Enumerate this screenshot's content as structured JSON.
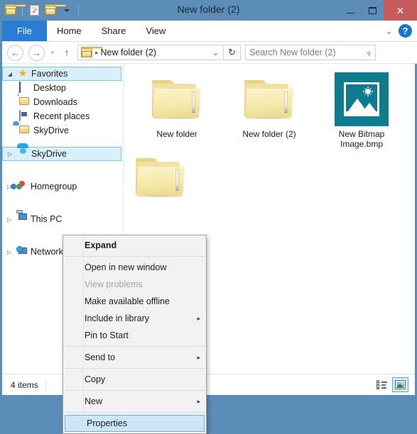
{
  "window": {
    "title": "New folder (2)",
    "quick_access": [
      {
        "name": "folder-icon",
        "label": "System menu"
      },
      {
        "name": "properties-icon",
        "label": "Properties"
      },
      {
        "name": "new-folder-icon",
        "label": "New folder"
      },
      {
        "name": "customize-caret-icon",
        "label": "Customize Quick Access Toolbar"
      }
    ],
    "controls": {
      "minimize": "–",
      "maximize": "☐",
      "close": "✕"
    },
    "accent_color": "#5b8db8",
    "close_color": "#c75b5b"
  },
  "ribbon": {
    "tabs": [
      {
        "label": "File",
        "active": true
      },
      {
        "label": "Home",
        "active": false
      },
      {
        "label": "Share",
        "active": false
      },
      {
        "label": "View",
        "active": false
      }
    ],
    "expand_caret": "⌄",
    "help_label": "?"
  },
  "addressbar": {
    "back": "←",
    "forward": "→",
    "history_caret": "▾",
    "up": "↑",
    "crumbs": [
      "New folder (2)"
    ],
    "crumb_separator": "▸",
    "dropdown_caret": "⌄",
    "refresh": "↻",
    "search": {
      "placeholder": "Search New folder (2)",
      "value": "",
      "icon": "⌕"
    }
  },
  "sidebar": {
    "groups": [
      {
        "root": {
          "label": "Favorites",
          "icon": "star-icon",
          "expander": "◢",
          "selected": true
        },
        "children": [
          {
            "label": "Desktop",
            "icon": "desktop-icon"
          },
          {
            "label": "Downloads",
            "icon": "downloads-icon"
          },
          {
            "label": "Recent places",
            "icon": "recent-places-icon"
          },
          {
            "label": "SkyDrive",
            "icon": "skydrive-folder-icon"
          }
        ]
      },
      {
        "root": {
          "label": "SkyDrive",
          "icon": "cloud-icon",
          "expander": "▷",
          "selected": true
        },
        "children": []
      },
      {
        "root": {
          "label": "Homegroup",
          "icon": "homegroup-icon",
          "expander": "▷",
          "selected": false
        },
        "children": []
      },
      {
        "root": {
          "label": "This PC",
          "icon": "this-pc-icon",
          "expander": "▷",
          "selected": false
        },
        "children": []
      },
      {
        "root": {
          "label": "Network",
          "icon": "network-icon",
          "expander": "▷",
          "selected": false
        },
        "children": []
      }
    ]
  },
  "content": {
    "items": [
      {
        "label": "New folder",
        "type": "folder"
      },
      {
        "label": "New folder (2)",
        "type": "folder"
      },
      {
        "label": "New Bitmap\nImage.bmp",
        "label_line1": "New Bitmap",
        "label_line2": "Image.bmp",
        "type": "bitmap",
        "thumb_color": "#0f7b8f"
      }
    ],
    "hidden_item": {
      "label": "",
      "type": "folder"
    }
  },
  "context_menu": {
    "items": [
      {
        "label": "Expand",
        "bold": true,
        "disabled": false,
        "submenu": false,
        "selected": false
      },
      {
        "type": "separator"
      },
      {
        "label": "Open in new window",
        "bold": false,
        "disabled": false,
        "submenu": false,
        "selected": false
      },
      {
        "label": "View problems",
        "bold": false,
        "disabled": true,
        "submenu": false,
        "selected": false
      },
      {
        "label": "Make available offline",
        "bold": false,
        "disabled": false,
        "submenu": false,
        "selected": false
      },
      {
        "label": "Include in library",
        "bold": false,
        "disabled": false,
        "submenu": true,
        "selected": false
      },
      {
        "label": "Pin to Start",
        "bold": false,
        "disabled": false,
        "submenu": false,
        "selected": false
      },
      {
        "type": "separator"
      },
      {
        "label": "Send to",
        "bold": false,
        "disabled": false,
        "submenu": true,
        "selected": false
      },
      {
        "type": "separator"
      },
      {
        "label": "Copy",
        "bold": false,
        "disabled": false,
        "submenu": false,
        "selected": false
      },
      {
        "type": "separator"
      },
      {
        "label": "New",
        "bold": false,
        "disabled": false,
        "submenu": true,
        "selected": false
      },
      {
        "type": "separator"
      },
      {
        "label": "Properties",
        "bold": false,
        "disabled": false,
        "submenu": false,
        "selected": true
      }
    ],
    "submenu_arrow": "▸"
  },
  "statusbar": {
    "item_count": "4 items",
    "views": [
      {
        "name": "details-view-button",
        "active": false
      },
      {
        "name": "large-icons-view-button",
        "active": true
      }
    ]
  }
}
